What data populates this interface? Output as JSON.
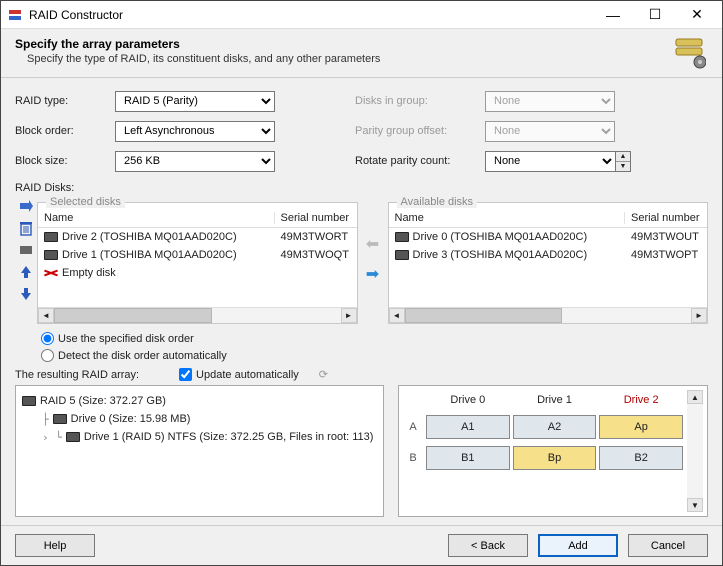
{
  "window": {
    "title": "RAID Constructor"
  },
  "header": {
    "title": "Specify the array parameters",
    "subtitle": "Specify the type of RAID, its constituent disks, and any other parameters"
  },
  "labels": {
    "raid_type": "RAID type:",
    "block_order": "Block order:",
    "block_size": "Block size:",
    "disks_in_group": "Disks in group:",
    "parity_group_offset": "Parity group offset:",
    "rotate_parity_count": "Rotate parity count:",
    "raid_disks": "RAID Disks:",
    "selected_disks": "Selected disks",
    "available_disks": "Available disks",
    "name_col": "Name",
    "serial_col": "Serial number",
    "use_specified": "Use the specified disk order",
    "detect_auto": "Detect the disk order automatically",
    "resulting": "The resulting RAID array:",
    "update_auto": "Update automatically"
  },
  "values": {
    "raid_type": "RAID 5 (Parity)",
    "block_order": "Left Asynchronous",
    "block_size": "256 KB",
    "disks_in_group": "None",
    "parity_group_offset": "None",
    "rotate_parity_count": "None"
  },
  "selected_disks": [
    {
      "name": "Drive 2 (TOSHIBA MQ01AAD020C)",
      "serial": "49M3TWORT",
      "icon": "hdd"
    },
    {
      "name": "Drive 1 (TOSHIBA MQ01AAD020C)",
      "serial": "49M3TWOQT",
      "icon": "hdd"
    },
    {
      "name": "Empty disk",
      "serial": "",
      "icon": "empty"
    }
  ],
  "available_disks": [
    {
      "name": "Drive 0 (TOSHIBA MQ01AAD020C)",
      "serial": "49M3TWOUT",
      "icon": "hdd"
    },
    {
      "name": "Drive 3 (TOSHIBA MQ01AAD020C)",
      "serial": "49M3TWOPT",
      "icon": "hdd"
    }
  ],
  "tree": {
    "root": "RAID 5 (Size: 372.27 GB)",
    "child0": "Drive 0 (Size: 15.98 MB)",
    "child1": "Drive 1 (RAID 5) NTFS (Size: 372.25 GB, Files in root: 113)"
  },
  "parity": {
    "headers": [
      "Drive 0",
      "Drive 1",
      "Drive 2"
    ],
    "rows": [
      {
        "label": "A",
        "cells": [
          {
            "t": "A1",
            "p": false
          },
          {
            "t": "A2",
            "p": false
          },
          {
            "t": "Ap",
            "p": true
          }
        ]
      },
      {
        "label": "B",
        "cells": [
          {
            "t": "B1",
            "p": false
          },
          {
            "t": "Bp",
            "p": true
          },
          {
            "t": "B2",
            "p": false
          }
        ]
      }
    ],
    "highlight_col": 2
  },
  "buttons": {
    "help": "Help",
    "back": "< Back",
    "add": "Add",
    "cancel": "Cancel"
  }
}
